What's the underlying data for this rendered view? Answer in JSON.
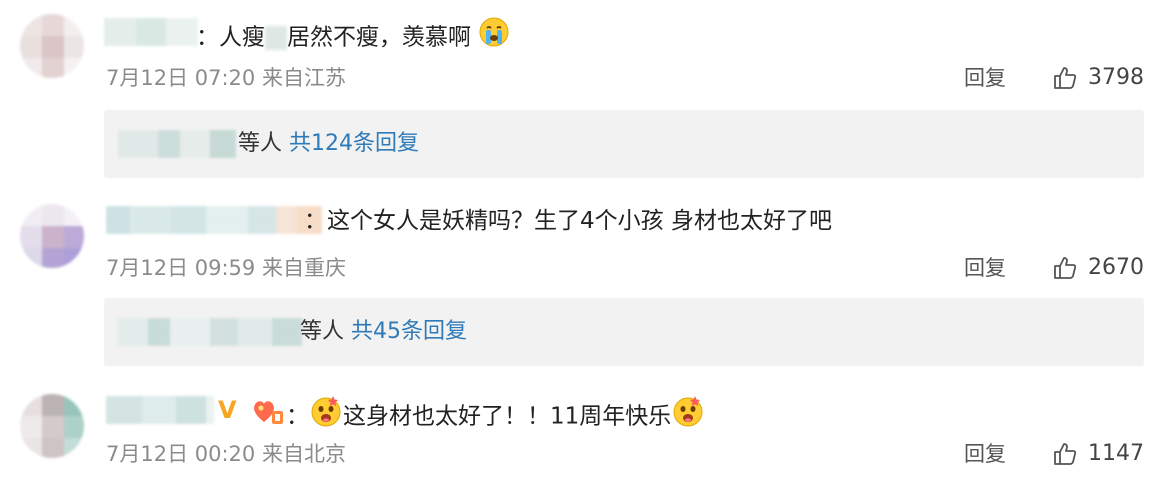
{
  "comments": [
    {
      "text_before": "：人瘦",
      "text_after": "居然不瘦，羡慕啊",
      "time": "7月12日 07:20 来自江苏",
      "reply_label": "回复",
      "likes": "3798",
      "replies_who": "等人",
      "replies_count": "共124条回复"
    },
    {
      "text": "：这个女人是妖精吗？生了4个小孩 身材也太好了吧",
      "time": "7月12日 09:59 来自重庆",
      "reply_label": "回复",
      "likes": "2670",
      "replies_who": "等人",
      "replies_count": "共45条回复"
    },
    {
      "text_main": "这身材也太好了！！11周年快乐",
      "badge": "V",
      "time": "7月12日 00:20 来自北京",
      "reply_label": "回复",
      "likes": "1147"
    }
  ],
  "icons": {
    "like": "thumbs-up-icon",
    "crying": "crying-emoji-icon",
    "drool": "drooling-face-emoji-icon",
    "fanclub": "fan-club-badge-icon"
  },
  "colors": {
    "link": "#2f7ab8",
    "meta": "#8b8b8b",
    "reply_box": "#f2f2f2",
    "badge": "#f5a623"
  }
}
